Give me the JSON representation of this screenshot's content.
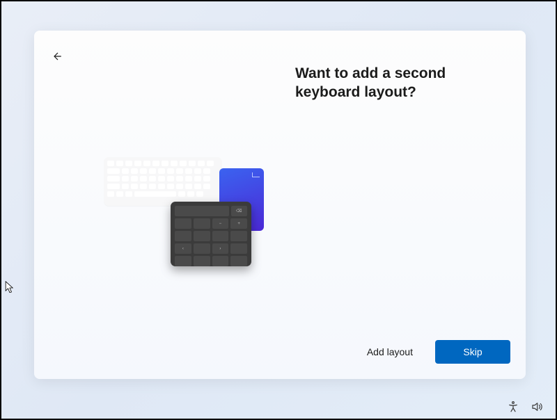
{
  "heading": "Want to add a second keyboard layout?",
  "buttons": {
    "add_layout": "Add layout",
    "skip": "Skip"
  },
  "icons": {
    "back": "back-arrow-icon",
    "accessibility": "accessibility-icon",
    "sound": "sound-icon"
  }
}
